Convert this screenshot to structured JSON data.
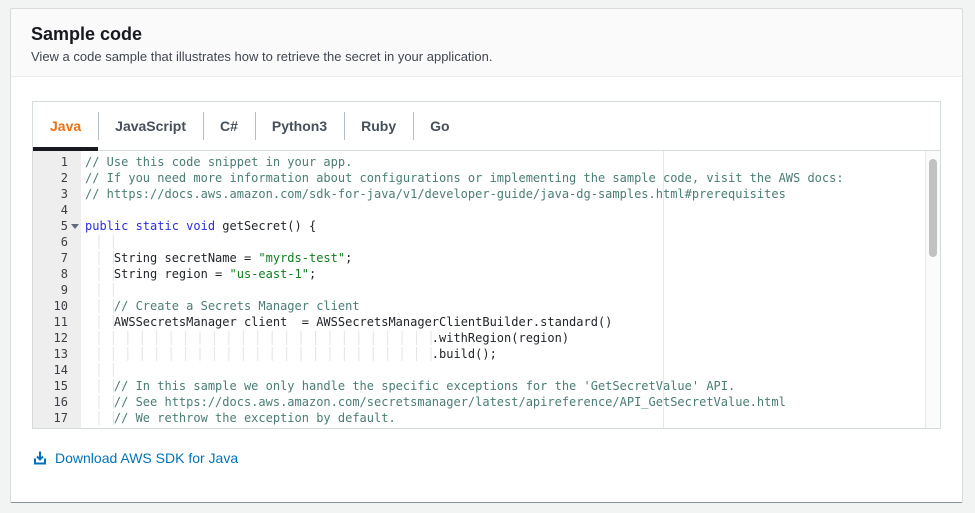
{
  "panel": {
    "title": "Sample code",
    "description": "View a code sample that illustrates how to retrieve the secret in your application."
  },
  "tabs": {
    "items": [
      {
        "label": "Java",
        "active": true
      },
      {
        "label": "JavaScript",
        "active": false
      },
      {
        "label": "C#",
        "active": false
      },
      {
        "label": "Python3",
        "active": false
      },
      {
        "label": "Ruby",
        "active": false
      },
      {
        "label": "Go",
        "active": false
      }
    ]
  },
  "editor": {
    "language": "Java",
    "print_margin_column": 80,
    "lines": [
      {
        "n": 1,
        "tokens": [
          [
            "comment",
            "// Use this code snippet in your app."
          ]
        ]
      },
      {
        "n": 2,
        "tokens": [
          [
            "comment",
            "// If you need more information about configurations or implementing the sample code, visit the AWS docs:"
          ]
        ]
      },
      {
        "n": 3,
        "tokens": [
          [
            "comment",
            "// https://docs.aws.amazon.com/sdk-for-java/v1/developer-guide/java-dg-samples.html#prerequisites"
          ]
        ]
      },
      {
        "n": 4,
        "tokens": []
      },
      {
        "n": 5,
        "fold": true,
        "tokens": [
          [
            "keyword",
            "public static void"
          ],
          [
            "plain",
            " getSecret() {"
          ]
        ]
      },
      {
        "n": 6,
        "tokens": [
          [
            "indent",
            "    "
          ]
        ]
      },
      {
        "n": 7,
        "tokens": [
          [
            "indent",
            "    "
          ],
          [
            "plain",
            "String secretName = "
          ],
          [
            "string",
            "\"myrds-test\""
          ],
          [
            "plain",
            ";"
          ]
        ]
      },
      {
        "n": 8,
        "tokens": [
          [
            "indent",
            "    "
          ],
          [
            "plain",
            "String region = "
          ],
          [
            "string",
            "\"us-east-1\""
          ],
          [
            "plain",
            ";"
          ]
        ]
      },
      {
        "n": 9,
        "tokens": [
          [
            "indent",
            "    "
          ]
        ]
      },
      {
        "n": 10,
        "tokens": [
          [
            "indent",
            "    "
          ],
          [
            "comment",
            "// Create a Secrets Manager client"
          ]
        ]
      },
      {
        "n": 11,
        "tokens": [
          [
            "indent",
            "    "
          ],
          [
            "plain",
            "AWSSecretsManager client  = AWSSecretsManagerClientBuilder.standard()"
          ]
        ]
      },
      {
        "n": 12,
        "tokens": [
          [
            "indent",
            "                                                "
          ],
          [
            "plain",
            ".withRegion(region)"
          ]
        ]
      },
      {
        "n": 13,
        "tokens": [
          [
            "indent",
            "                                                "
          ],
          [
            "plain",
            ".build();"
          ]
        ]
      },
      {
        "n": 14,
        "tokens": [
          [
            "indent",
            "    "
          ]
        ]
      },
      {
        "n": 15,
        "tokens": [
          [
            "indent",
            "    "
          ],
          [
            "comment",
            "// In this sample we only handle the specific exceptions for the 'GetSecretValue' API."
          ]
        ]
      },
      {
        "n": 16,
        "tokens": [
          [
            "indent",
            "    "
          ],
          [
            "comment",
            "// See https://docs.aws.amazon.com/secretsmanager/latest/apireference/API_GetSecretValue.html"
          ]
        ]
      },
      {
        "n": 17,
        "tokens": [
          [
            "indent",
            "    "
          ],
          [
            "comment",
            "// We rethrow the exception by default."
          ]
        ]
      }
    ]
  },
  "footer": {
    "download_label": "Download AWS SDK for Java"
  },
  "colors": {
    "accent_orange": "#ec7211",
    "active_tab_underline": "#16191f",
    "link_blue": "#0073bb",
    "comment": "#4b7d76",
    "keyword": "#2d2de1",
    "string": "#0f7d1f",
    "page_background": "#f2f3f3"
  }
}
